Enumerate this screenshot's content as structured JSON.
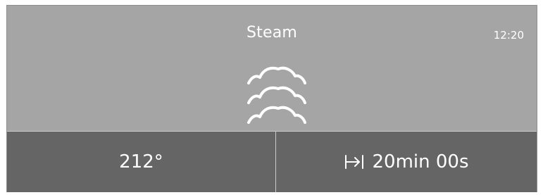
{
  "screen": {
    "title": "Steam",
    "time": "12:20",
    "mode_icon": "steam-icon"
  },
  "settings": {
    "temperature": "212°",
    "timer_icon": "timer-end-icon",
    "duration": "20min 00s"
  },
  "colors": {
    "header_bg": "#a5a5a5",
    "footer_bg": "#656565",
    "text": "#ffffff"
  }
}
